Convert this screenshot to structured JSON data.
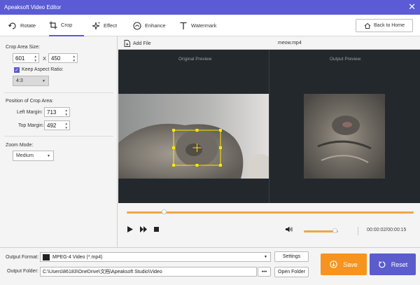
{
  "window": {
    "title": "Apeaksoft Video Editor"
  },
  "tabs": [
    {
      "label": "Rotate",
      "icon": "rotate-icon"
    },
    {
      "label": "Crop",
      "icon": "crop-icon",
      "active": true
    },
    {
      "label": "Effect",
      "icon": "effect-icon"
    },
    {
      "label": "Enhance",
      "icon": "enhance-icon"
    },
    {
      "label": "Watermark",
      "icon": "watermark-icon"
    }
  ],
  "back_home_label": "Back to Home",
  "crop": {
    "area_size_label": "Crop Area Size:",
    "width": "601",
    "times": "X",
    "height": "450",
    "keep_aspect_label": "Keep Aspect Ratio:",
    "keep_aspect_checked": true,
    "aspect_value": "4:3",
    "position_label": "Position of Crop Area:",
    "left_margin_label": "Left Margin:",
    "left_margin": "713",
    "top_margin_label": "Top Margin:",
    "top_margin": "492",
    "zoom_label": "Zoom Mode:",
    "zoom_value": "Medium"
  },
  "file": {
    "add_label": "Add File",
    "name": "meow.mp4"
  },
  "preview": {
    "original_label": "Original Preview",
    "output_label": "Output Preview"
  },
  "playback": {
    "progress": 0.13,
    "volume": 0.9,
    "time": "00:00:02/00:00:15"
  },
  "output": {
    "format_label": "Output Format:",
    "format_value": "MPEG-4 Video (*.mp4)",
    "settings_label": "Settings",
    "folder_label": "Output Folder:",
    "folder_value": "C:\\Users\\86183\\OneDrive\\文档\\Apeaksoft Studio\\Video",
    "browse_label": "•••",
    "open_folder_label": "Open Folder",
    "save_label": "Save",
    "reset_label": "Reset"
  },
  "colors": {
    "accent": "#5b5bd6",
    "orange": "#f7941d",
    "crop_box": "#ffe600"
  }
}
